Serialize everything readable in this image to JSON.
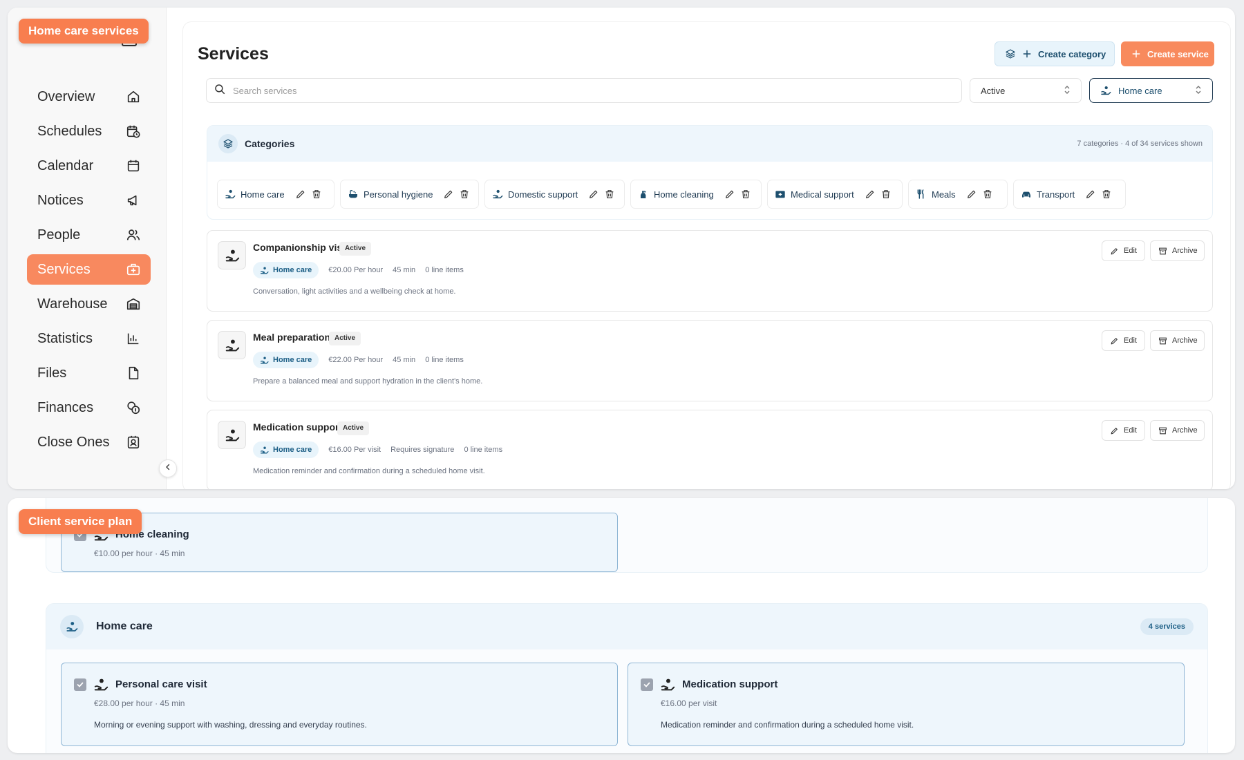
{
  "callouts": {
    "top": "Home care services",
    "bottom": "Client service plan"
  },
  "colors": {
    "accent": "#f8895f",
    "navy": "#1d4f6e",
    "light_blue": "#eef6fc"
  },
  "sidebar": {
    "items": [
      {
        "label": "Overview",
        "icon": "home-icon"
      },
      {
        "label": "Schedules",
        "icon": "calendar-clock-icon"
      },
      {
        "label": "Calendar",
        "icon": "calendar-icon"
      },
      {
        "label": "Notices",
        "icon": "megaphone-icon"
      },
      {
        "label": "People",
        "icon": "users-icon"
      },
      {
        "label": "Services",
        "icon": "medical-bag-icon",
        "active": true
      },
      {
        "label": "Warehouse",
        "icon": "warehouse-icon"
      },
      {
        "label": "Statistics",
        "icon": "bar-chart-icon"
      },
      {
        "label": "Files",
        "icon": "file-icon"
      },
      {
        "label": "Finances",
        "icon": "coins-icon"
      },
      {
        "label": "Close Ones",
        "icon": "contact-icon"
      }
    ]
  },
  "header": {
    "title": "Services",
    "create_category_label": "Create category",
    "create_service_label": "Create service"
  },
  "search": {
    "placeholder": "Search services",
    "value": ""
  },
  "filters": {
    "status_value": "Active",
    "category_value": "Home care"
  },
  "categories": {
    "title": "Categories",
    "summary": "7 categories · 4 of 34 services shown",
    "items": [
      {
        "label": "Home care",
        "icon": "hand-heart-icon"
      },
      {
        "label": "Personal hygiene",
        "icon": "bath-icon"
      },
      {
        "label": "Domestic support",
        "icon": "hand-heart-icon"
      },
      {
        "label": "Home cleaning",
        "icon": "spray-bottle-icon"
      },
      {
        "label": "Medical support",
        "icon": "first-aid-icon"
      },
      {
        "label": "Meals",
        "icon": "utensils-icon"
      },
      {
        "label": "Transport",
        "icon": "car-icon"
      }
    ]
  },
  "services": [
    {
      "name": "Companionship visit",
      "status": "Active",
      "category": "Home care",
      "meta": [
        "€20.00 Per hour",
        "45 min",
        "0 line items"
      ],
      "description": "Conversation, light activities and a wellbeing check at home."
    },
    {
      "name": "Meal preparation",
      "status": "Active",
      "category": "Home care",
      "meta": [
        "€22.00 Per hour",
        "45 min",
        "0 line items"
      ],
      "description": "Prepare a balanced meal and support hydration in the client's home."
    },
    {
      "name": "Medication support",
      "status": "Active",
      "category": "Home care",
      "meta": [
        "€16.00 Per visit",
        "Requires signature",
        "0 line items"
      ],
      "description": "Medication reminder and confirmation during a scheduled home visit."
    }
  ],
  "row_actions": {
    "edit": "Edit",
    "archive": "Archive"
  },
  "plan": {
    "partial_card": {
      "title": "Home cleaning",
      "sub": "€10.00 per hour · 45 min"
    },
    "group": {
      "title": "Home care",
      "count": "4 services",
      "cards": [
        {
          "title": "Personal care visit",
          "sub": "€28.00 per hour · 45 min",
          "description": "Morning or evening support with washing, dressing and everyday routines."
        },
        {
          "title": "Medication support",
          "sub": "€16.00 per visit",
          "description": "Medication reminder and confirmation during a scheduled home visit."
        }
      ]
    }
  }
}
